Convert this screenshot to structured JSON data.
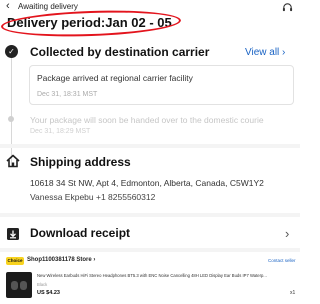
{
  "header": {
    "back_icon": "chevron-left-icon",
    "title": "Awaiting delivery",
    "support_icon": "headset-icon"
  },
  "delivery_period": "Delivery period:Jan 02 - 05",
  "tracking": {
    "title": "Collected by destination carrier",
    "view_all": "View all",
    "latest_event": "Package arrived at regional carrier facility",
    "latest_time": "Dec 31, 18:31 MST",
    "previous_event": "Your package will soon be handed over to the domestic courie",
    "previous_time": "Dec 31, 18:29 MST"
  },
  "shipping": {
    "title": "Shipping address",
    "address": "10618 34 St NW, Apt 4, Edmonton, Alberta, Canada, C5W1Y2",
    "contact": "Vanessa Ekpebu +1 8255560312"
  },
  "receipt": {
    "title": "Download receipt"
  },
  "store": {
    "badge": "Choice",
    "name": "Shop1100381178 Store",
    "contact_seller": "Contact seller"
  },
  "product": {
    "title": "New Wireless Earbuds HiFi Stereo Headphones BT5.3 with ENC Noise Cancelling 48H LED Display Ear Buds IP7 Waterp...",
    "variant": "Black",
    "price": "US $4.23",
    "quantity": "x1"
  },
  "colors": {
    "accent_link": "#1a63c4",
    "highlight_circle": "#e3141d",
    "choice_badge": "#f8d31e"
  }
}
